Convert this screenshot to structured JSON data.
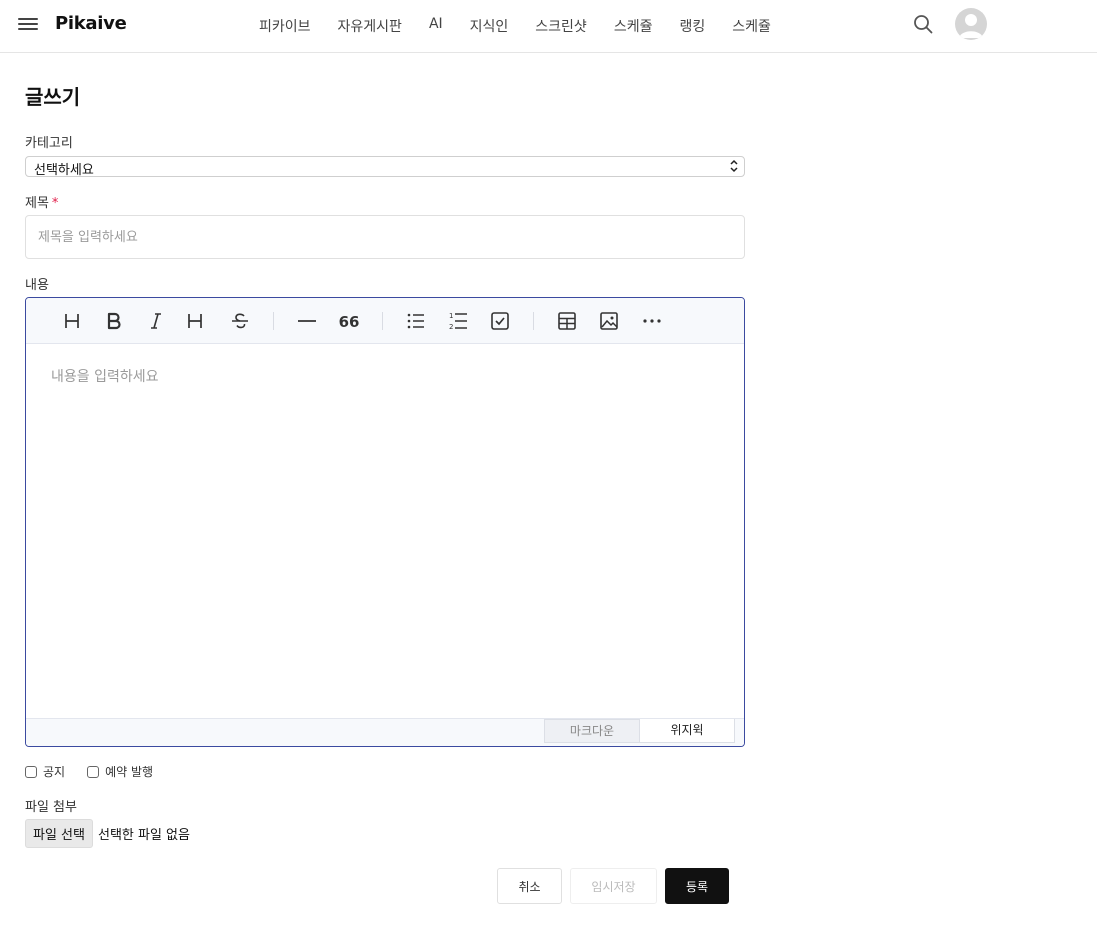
{
  "header": {
    "logo": "Pikaive",
    "nav": [
      "피카이브",
      "자유게시판",
      "AI",
      "지식인",
      "스크린샷",
      "스케쥴",
      "랭킹",
      "스케쥴"
    ]
  },
  "page": {
    "title": "글쓰기"
  },
  "form": {
    "category_label": "카테고리",
    "category_value": "선택하세요",
    "title_label": "제목",
    "title_required_mark": "*",
    "title_placeholder": "제목을 입력하세요",
    "content_label": "내용",
    "content_placeholder": "내용을 입력하세요",
    "mode_markdown": "마크다운",
    "mode_wysiwyg": "위지윅",
    "notice_label": "공지",
    "scheduled_label": "예약 발행",
    "attach_label": "파일 첨부",
    "file_button": "파일 선택",
    "file_status": "선택한 파일 없음"
  },
  "actions": {
    "cancel": "취소",
    "draft": "임시저장",
    "submit": "등록"
  },
  "colors": {
    "editor_border": "#3b4aa0",
    "submit_bg": "#111111",
    "required": "#e11d48"
  }
}
